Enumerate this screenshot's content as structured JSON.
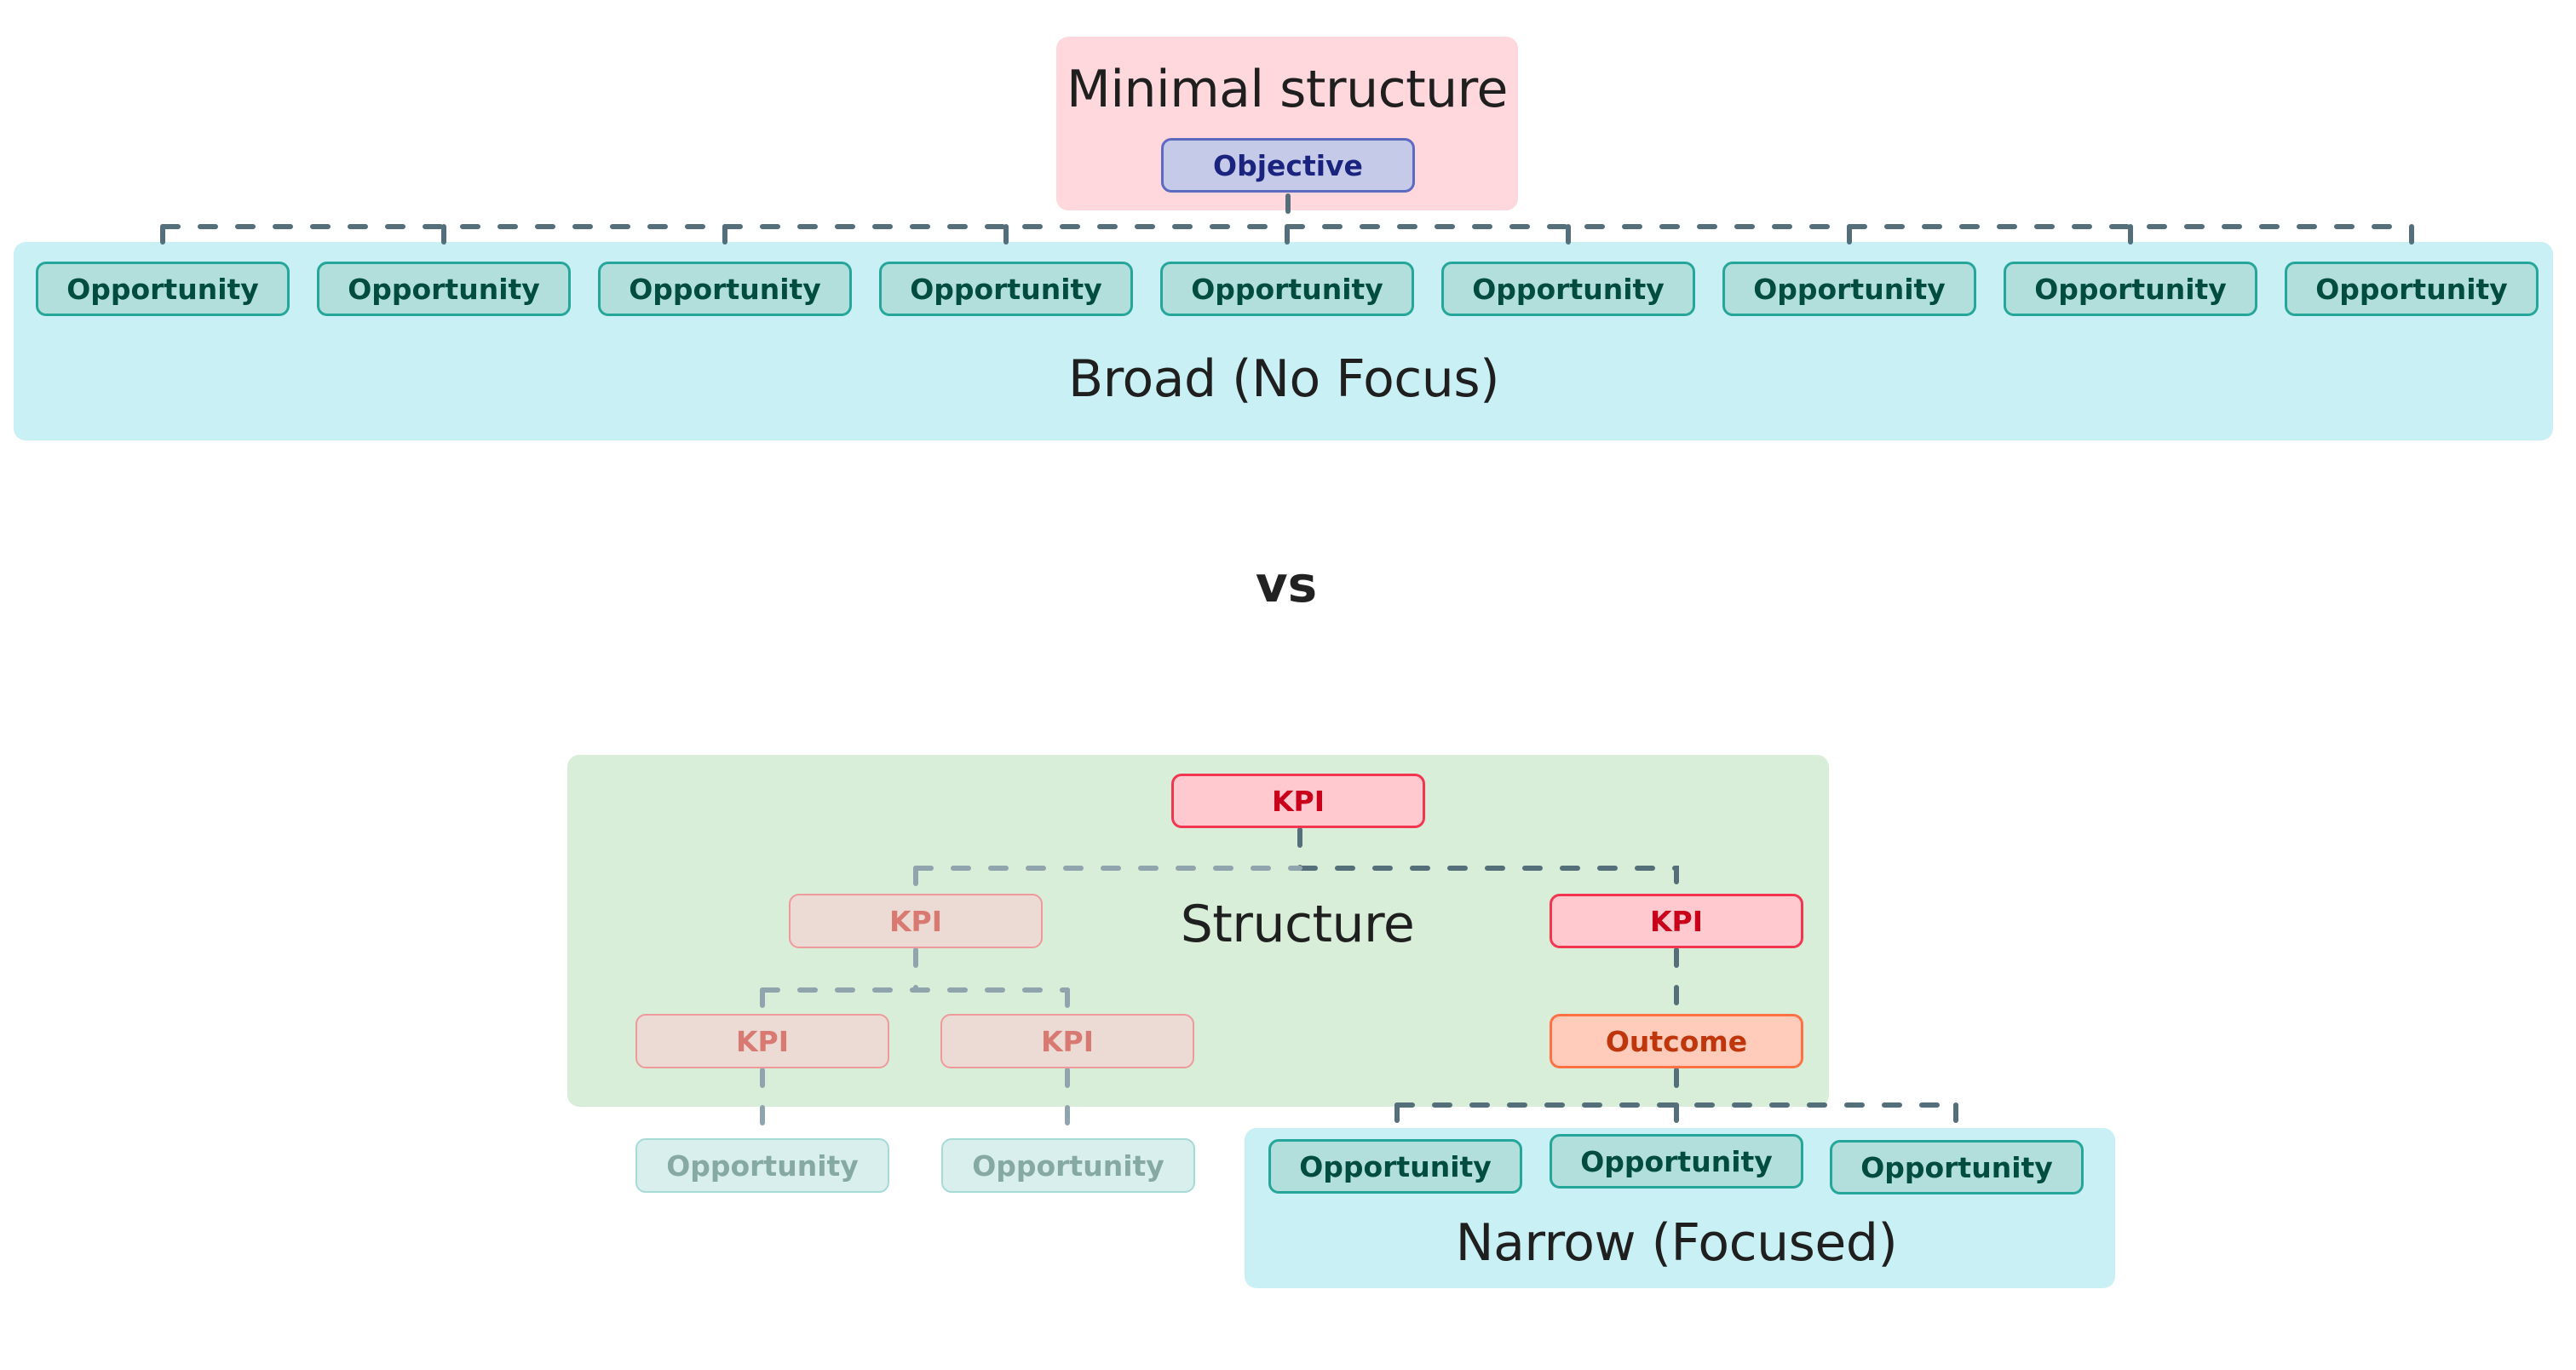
{
  "top_section": {
    "title": "Minimal structure",
    "objective_label": "Objective",
    "opportunities": [
      "Opportunity",
      "Opportunity",
      "Opportunity",
      "Opportunity",
      "Opportunity",
      "Opportunity",
      "Opportunity",
      "Opportunity",
      "Opportunity"
    ],
    "panel_label": "Broad (No Focus)"
  },
  "separator": {
    "label": "vs"
  },
  "bottom_section": {
    "structure_label": "Structure",
    "root_kpi": "KPI",
    "faded_branch": {
      "kpi": "KPI",
      "child_kpis": [
        "KPI",
        "KPI"
      ],
      "opportunities": [
        "Opportunity",
        "Opportunity"
      ]
    },
    "focused_branch": {
      "kpi": "KPI",
      "outcome": "Outcome",
      "opportunities": [
        "Opportunity",
        "Opportunity",
        "Opportunity"
      ]
    },
    "panel_label": "Narrow (Focused)"
  },
  "colors": {
    "connector_dark": "#546e7a",
    "connector_faded": "#90a4ae",
    "opportunity_fill": "#b2dfdb",
    "opportunity_border": "#26a69a",
    "kpi_fill": "#ffc9cf",
    "kpi_border": "#f2364f",
    "outcome_fill": "#ffccbc",
    "objective_fill": "#c5cae9"
  }
}
